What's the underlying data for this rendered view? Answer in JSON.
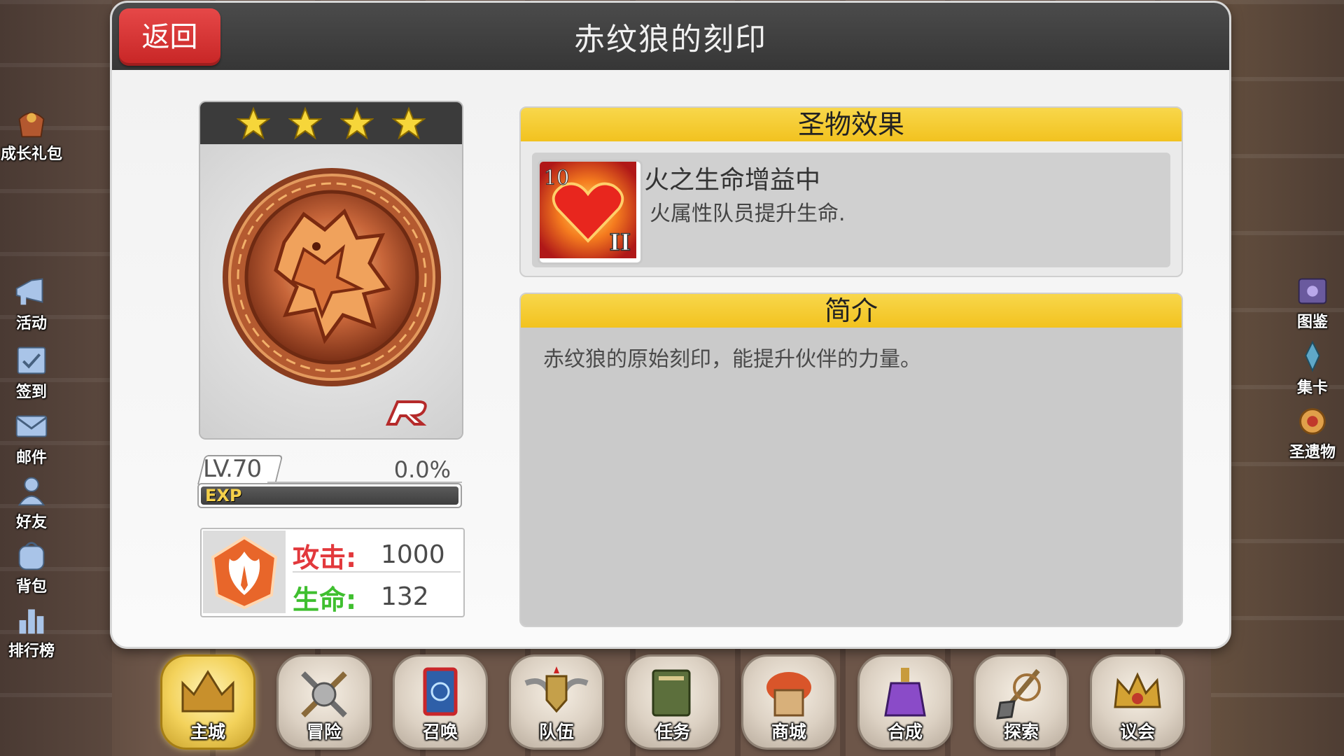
{
  "header": {
    "title": "赤纹狼的刻印",
    "back_label": "返回"
  },
  "side_left": [
    {
      "label": "成长礼包",
      "icon": "gift-bag-icon"
    },
    {
      "label": "活动",
      "icon": "megaphone-icon"
    },
    {
      "label": "签到",
      "icon": "checkin-icon"
    },
    {
      "label": "邮件",
      "icon": "mail-icon"
    },
    {
      "label": "好友",
      "icon": "friends-icon"
    },
    {
      "label": "背包",
      "icon": "backpack-icon"
    },
    {
      "label": "排行榜",
      "icon": "ranking-icon"
    }
  ],
  "side_right": [
    {
      "label": "图鉴",
      "icon": "book-icon"
    },
    {
      "label": "集卡",
      "icon": "card-collect-icon"
    },
    {
      "label": "圣遗物",
      "icon": "relic-icon"
    }
  ],
  "relic": {
    "stars": 4,
    "rarity": "R",
    "level": "LV.70",
    "exp_percent": "0.0%",
    "exp_fraction": 0.0,
    "exp_label": "EXP"
  },
  "stats": {
    "attack_label": "攻击:",
    "attack_value": "1000",
    "hp_label": "生命:",
    "hp_value": "132"
  },
  "effect": {
    "header": "圣物效果",
    "skill_level": "10",
    "skill_tier": "II",
    "skill_name": "火之生命增益中",
    "skill_desc": "火属性队员提升生命."
  },
  "intro": {
    "header": "简介",
    "text": "赤纹狼的原始刻印，能提升伙伴的力量。"
  },
  "bottom_nav": [
    {
      "label": "主城",
      "icon": "castle-crown-icon",
      "active": true
    },
    {
      "label": "冒险",
      "icon": "crossed-weapons-icon",
      "active": false
    },
    {
      "label": "召唤",
      "icon": "summon-card-icon",
      "active": false
    },
    {
      "label": "队伍",
      "icon": "winged-shield-icon",
      "active": false
    },
    {
      "label": "任务",
      "icon": "quest-book-icon",
      "active": false
    },
    {
      "label": "商城",
      "icon": "shop-icon",
      "active": false
    },
    {
      "label": "合成",
      "icon": "potion-icon",
      "active": false
    },
    {
      "label": "探索",
      "icon": "shovel-icon",
      "active": false
    },
    {
      "label": "议会",
      "icon": "council-crown-icon",
      "active": false
    }
  ],
  "colors": {
    "accent_yellow": "#f2c21f",
    "back_red": "#d93535",
    "attack_red": "#e2383c",
    "hp_green": "#3fbf2f",
    "header_dark": "#3e3e3e"
  }
}
